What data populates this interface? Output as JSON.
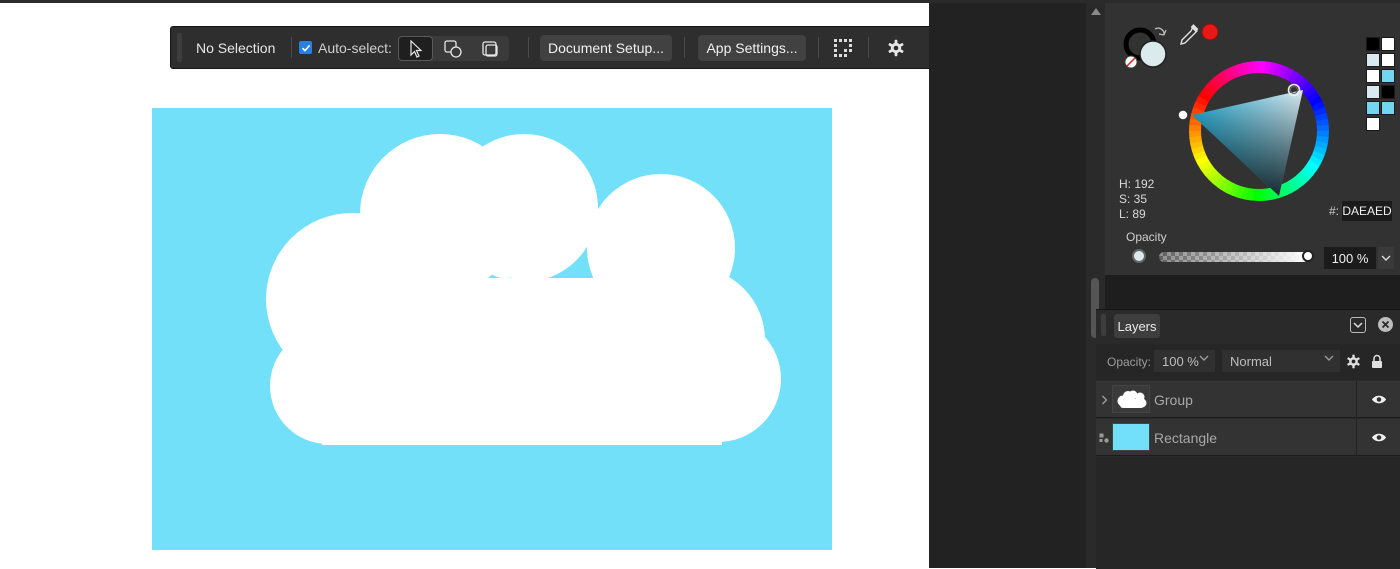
{
  "toolbar": {
    "selection_label": "No Selection",
    "auto_select_label": "Auto-select:",
    "auto_select_checked": true,
    "document_setup_label": "Document Setup...",
    "app_settings_label": "App Settings...",
    "modes": [
      "pointer-icon",
      "shape-select-icon",
      "container-select-icon"
    ]
  },
  "canvas": {
    "background_color": "#73E0FA",
    "cloud_color": "#FFFFFF"
  },
  "color_panel": {
    "h_label": "H: 192",
    "s_label": "S: 35",
    "l_label": "L: 89",
    "hex_prefix": "#:",
    "hex_value": "DAEAED",
    "opacity_label": "Opacity",
    "opacity_value": "100 %",
    "fill_color": "#DAEAED",
    "swatch_colors": [
      "#000000",
      "#FFFFFF",
      "#D8EAF0",
      "#FFFFFF",
      "#FFFFFF",
      "#73D5F0",
      "#D8EAF0",
      "#000000",
      "#73D5F0",
      "#73D5F0",
      "#FFFFFF"
    ]
  },
  "layers": {
    "tab_label": "Layers",
    "opacity_label": "Opacity:",
    "opacity_value": "100 %",
    "blend_mode": "Normal",
    "rows": [
      {
        "name": "Group",
        "visible": true
      },
      {
        "name": "Rectangle",
        "visible": true
      }
    ]
  }
}
